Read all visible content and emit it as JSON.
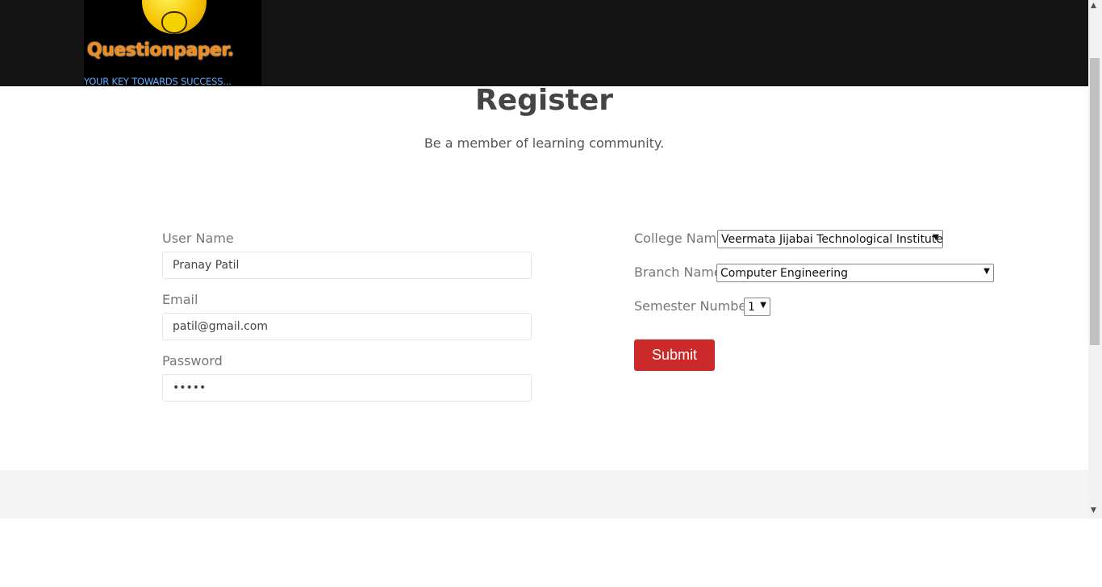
{
  "logo": {
    "brand": "Questionpaper.",
    "tagline": "YOUR KEY TOWARDS SUCCESS..."
  },
  "page": {
    "title": "Register",
    "subtitle": "Be a member of learning community."
  },
  "form": {
    "username": {
      "label": "User Name",
      "value": "Pranay Patil"
    },
    "email": {
      "label": "Email",
      "value": "patil@gmail.com"
    },
    "password": {
      "label": "Password",
      "value": "•••••"
    },
    "college": {
      "label": "College Name",
      "selected": "Veermata Jijabai Technological Institute"
    },
    "branch": {
      "label": "Branch Name",
      "selected": "Computer Engineering"
    },
    "semester": {
      "label": "Semester Number",
      "selected": "1"
    },
    "submit_label": "Submit"
  },
  "colors": {
    "topbar": "#141414",
    "submit": "#cc2a2a",
    "footer": "#f4f4f4"
  }
}
